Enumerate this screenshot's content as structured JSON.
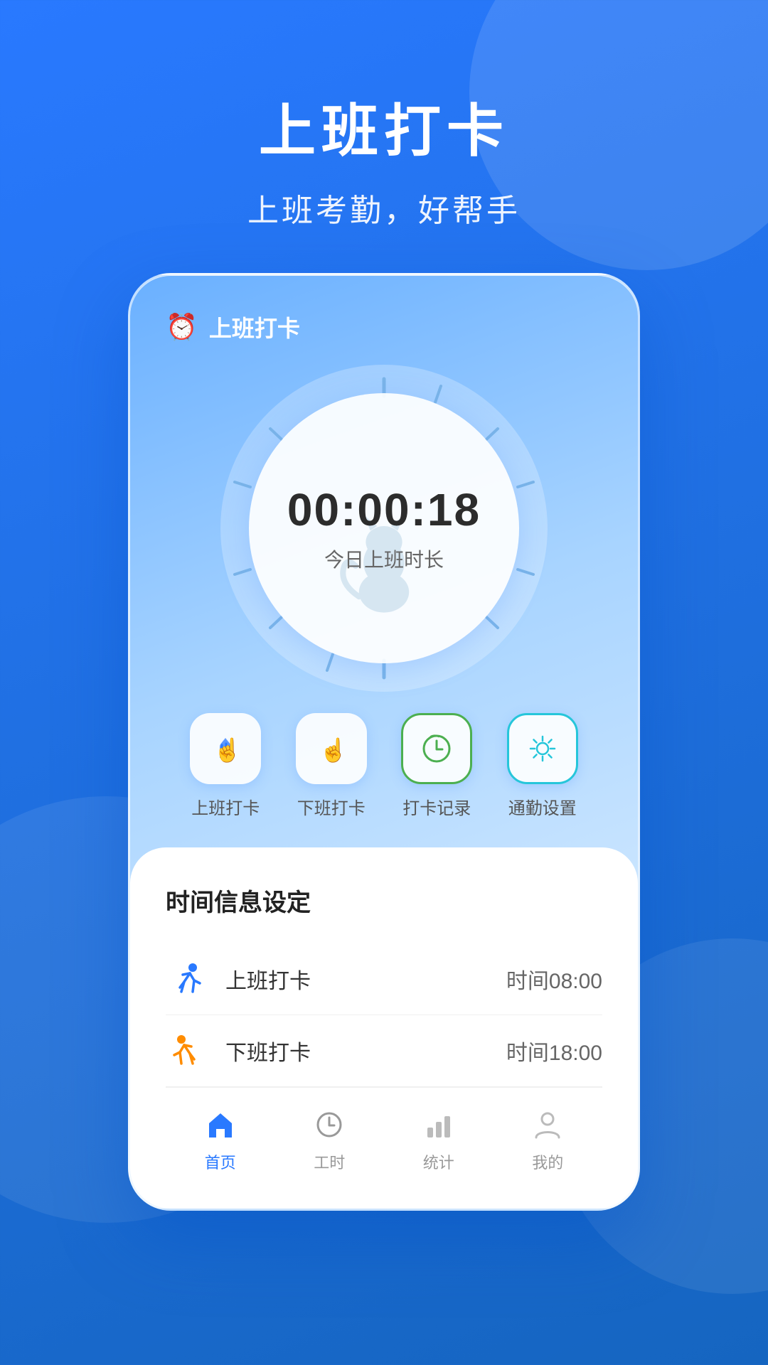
{
  "header": {
    "title": "上班打卡",
    "subtitle": "上班考勤，好帮手"
  },
  "app": {
    "name": "上班打卡",
    "clock": {
      "time": "00:00:18",
      "label": "今日上班时长"
    },
    "actions": [
      {
        "id": "checkin",
        "label": "上班打卡",
        "icon": "hand-point",
        "color": "blue"
      },
      {
        "id": "checkout",
        "label": "下班打卡",
        "icon": "hand-point-orange",
        "color": "orange"
      },
      {
        "id": "records",
        "label": "打卡记录",
        "icon": "clock-green",
        "color": "green"
      },
      {
        "id": "settings",
        "label": "通勤设置",
        "icon": "gear-teal",
        "color": "teal"
      }
    ],
    "info_panel": {
      "title": "时间信息设定",
      "rows": [
        {
          "id": "morning",
          "name": "上班打卡",
          "time": "时间08:00",
          "icon_color": "blue"
        },
        {
          "id": "evening",
          "name": "下班打卡",
          "time": "时间18:00",
          "icon_color": "orange"
        }
      ]
    },
    "nav": [
      {
        "id": "home",
        "label": "首页",
        "active": true
      },
      {
        "id": "hours",
        "label": "工时",
        "active": false
      },
      {
        "id": "stats",
        "label": "统计",
        "active": false
      },
      {
        "id": "mine",
        "label": "我的",
        "active": false
      }
    ]
  }
}
